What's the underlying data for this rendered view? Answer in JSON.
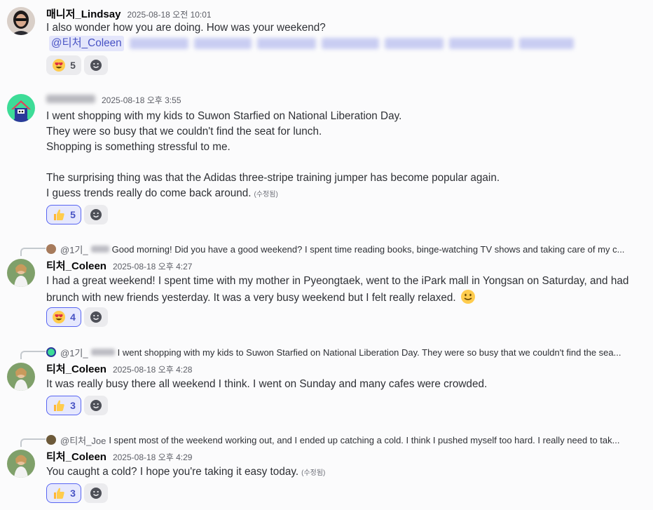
{
  "messages": [
    {
      "author": "매니저_Lindsay",
      "time": "2025-08-18 오전 10:01",
      "lines": [
        "I also wonder how you are doing. How was your weekend?"
      ],
      "mention": "@티처_Coleen",
      "reactions": [
        {
          "emoji": "heart-eyes",
          "count": "5",
          "active": false
        }
      ]
    },
    {
      "author": "",
      "time": "2025-08-18 오후 3:55",
      "lines": [
        "I went shopping with my kids to Suwon Starfied on National Liberation Day.",
        "They were so busy that we couldn't find the seat for lunch.",
        "Shopping is something stressful to me.",
        "",
        "The surprising thing was that the Adidas three-stripe training jumper has become popular again.",
        "I guess trends really do come back around."
      ],
      "edited": "(수정됨)",
      "reactions": [
        {
          "emoji": "thumbs-up",
          "count": "5",
          "active": true
        }
      ]
    },
    {
      "reply_handle": "@1기_",
      "reply_text": "Good morning! Did you have a good weekend? I spent time reading books, binge-watching TV shows and taking care of my c...",
      "author": "티처_Coleen",
      "time": "2025-08-18 오후 4:27",
      "lines": [
        "I had a great weekend! I spent time with my mother in Pyeongtaek, went to the iPark mall in Yongsan on Saturday, and had",
        "brunch with new friends yesterday. It was a very busy weekend but I felt really relaxed."
      ],
      "reactions": [
        {
          "emoji": "heart-eyes",
          "count": "4",
          "active": true
        }
      ]
    },
    {
      "reply_handle": "@1기_",
      "reply_text": "I went shopping with my kids to Suwon Starfied on National Liberation Day.  They were so busy that we couldn't find the sea...",
      "author": "티처_Coleen",
      "time": "2025-08-18 오후 4:28",
      "lines": [
        "It was really busy there all weekend I think. I went on Sunday and many cafes were crowded."
      ],
      "reactions": [
        {
          "emoji": "thumbs-up",
          "count": "3",
          "active": true
        }
      ]
    },
    {
      "reply_handle": "@티처_Joe",
      "reply_text": "I spent most of the weekend working out, and I ended up catching a cold. I think I pushed myself too hard. I really need to tak...",
      "author": "티처_Coleen",
      "time": "2025-08-18 오후 4:29",
      "lines": [
        "You caught a cold? I hope you're taking it easy today."
      ],
      "edited": "(수정됨)",
      "reactions": [
        {
          "emoji": "thumbs-up",
          "count": "3",
          "active": true
        }
      ]
    }
  ]
}
